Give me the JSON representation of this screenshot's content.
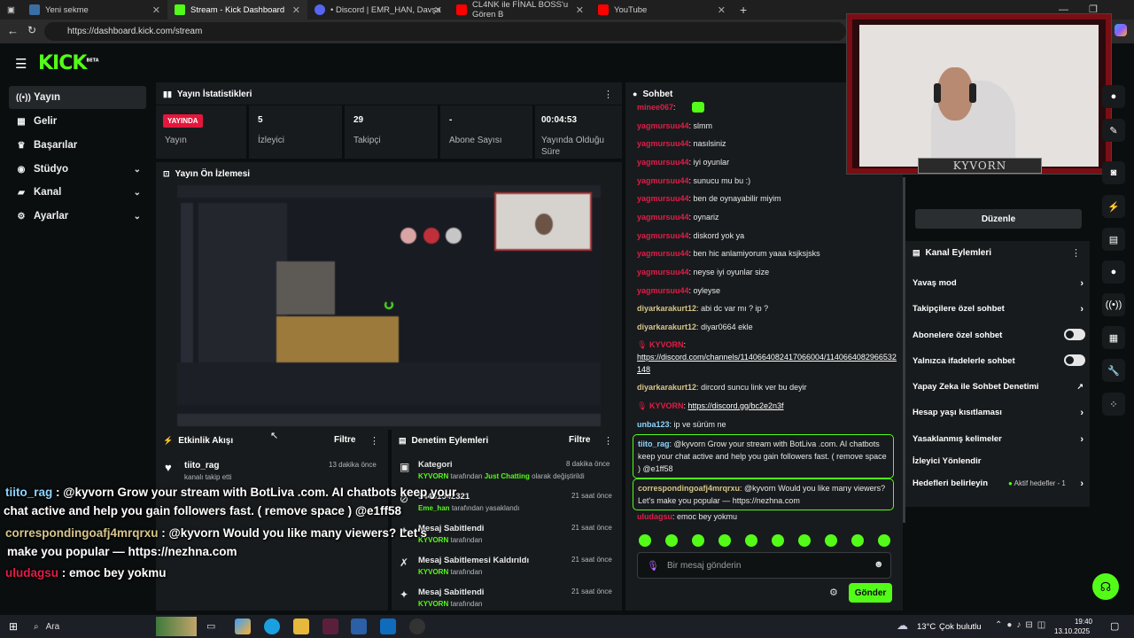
{
  "browser": {
    "tabs": [
      {
        "label": "Yeni sekme",
        "color": "#3a6ea5"
      },
      {
        "label": "Stream - Kick Dashboard",
        "color": "#53fc18"
      },
      {
        "label": "• Discord | EMR_HAN, Davşa",
        "color": "#5865f2"
      },
      {
        "label": "CL4NK ile FİNAL BOSS'u Gören B",
        "color": "#ff0000"
      },
      {
        "label": "YouTube",
        "color": "#ff0000"
      }
    ],
    "url": "https://dashboard.kick.com/stream"
  },
  "logo": {
    "text": "KICK",
    "sup": "BETA"
  },
  "sidebar": {
    "items": [
      {
        "label": "Yayın",
        "icon": "broadcast-icon"
      },
      {
        "label": "Gelir",
        "icon": "revenue-icon"
      },
      {
        "label": "Başarılar",
        "icon": "trophy-icon"
      },
      {
        "label": "Stüdyo",
        "icon": "studio-icon"
      },
      {
        "label": "Kanal",
        "icon": "channel-icon"
      },
      {
        "label": "Ayarlar",
        "icon": "gear-icon"
      }
    ]
  },
  "stats": {
    "title": "Yayın İstatistikleri",
    "live_badge": "YAYINDA",
    "items": [
      {
        "value": "",
        "label": "Yayın"
      },
      {
        "value": "5",
        "label": "İzleyici"
      },
      {
        "value": "29",
        "label": "Takipçi"
      },
      {
        "value": "-",
        "label": "Abone Sayısı"
      },
      {
        "value": "00:04:53",
        "label": "Yayında Olduğu Süre"
      }
    ]
  },
  "preview": {
    "title": "Yayın Ön İzlemesi"
  },
  "activity": {
    "title": "Etkinlik Akışı",
    "filter": "Filtre",
    "rows": [
      {
        "user": "tiito_rag",
        "desc": "kanalı takip etti",
        "time": "13 dakika önce"
      }
    ]
  },
  "moderation": {
    "title": "Denetim Eylemleri",
    "filter": "Filtre",
    "rows": [
      {
        "title": "Kategori",
        "actor": "KYVORN",
        "rest": "tarafından",
        "extra": "Just Chatting",
        "tail": "olarak değiştirildi",
        "time": "8 dakika önce"
      },
      {
        "title": "34461542321",
        "actor": "Eme_han",
        "rest": "tarafından yasaklandı",
        "extra": "",
        "tail": "",
        "time": "21 saat önce"
      },
      {
        "title": "Mesaj Sabitlendi",
        "actor": "KYVORN",
        "rest": "tarafından",
        "extra": "",
        "tail": "",
        "time": "21 saat önce"
      },
      {
        "title": "Mesaj Sabitlemesi Kaldırıldı",
        "actor": "KYVORN",
        "rest": "tarafından",
        "extra": "",
        "tail": "",
        "time": "21 saat önce"
      },
      {
        "title": "Mesaj Sabitlendi",
        "actor": "KYVORN",
        "rest": "tarafından",
        "extra": "",
        "tail": "",
        "time": "21 saat önce"
      }
    ]
  },
  "chat": {
    "title": "Sohbet",
    "messages": [
      {
        "user": "minee067",
        "text": "",
        "color": "#e11d48"
      },
      {
        "user": "yagmursuu44",
        "text": "slmm",
        "color": "#e11d48"
      },
      {
        "user": "yagmursuu44",
        "text": "nasılsiniz",
        "color": "#e11d48"
      },
      {
        "user": "yagmursuu44",
        "text": "iyi oyunlar",
        "color": "#e11d48"
      },
      {
        "user": "yagmursuu44",
        "text": "sunucu mu bu :)",
        "color": "#e11d48"
      },
      {
        "user": "yagmursuu44",
        "text": "ben de oynayabilir miyim",
        "color": "#e11d48"
      },
      {
        "user": "yagmursuu44",
        "text": "oynariz",
        "color": "#e11d48"
      },
      {
        "user": "yagmursuu44",
        "text": "diskord yok ya",
        "color": "#e11d48"
      },
      {
        "user": "yagmursuu44",
        "text": "ben hic anlamiyorum yaaa ksjksjsks",
        "color": "#e11d48"
      },
      {
        "user": "yagmursuu44",
        "text": "neyse iyi oyunlar size",
        "color": "#e11d48"
      },
      {
        "user": "yagmursuu44",
        "text": "oyleyse",
        "color": "#e11d48"
      },
      {
        "user": "diyarkarakurt12",
        "text": "abi dc var mı ? ip ?",
        "color": "#d7c58a"
      },
      {
        "user": "diyarkarakurt12",
        "text": "diyar0664 ekle",
        "color": "#d7c58a"
      }
    ],
    "kyvorn1_user": "KYVORN",
    "kyvorn1_link": "https://discord.com/channels/1140664082417066004/1140664082966532148",
    "diyar3_user": "diyarkarakurt12",
    "diyar3_text": "dircord suncu link ver bu deyir",
    "kyvorn2_user": "KYVORN",
    "kyvorn2_link": "https://discord.gg/bc2e2n3f",
    "unba_user": "unba123",
    "unba_text": "ip ve sürüm ne",
    "tiito_user": "tiito_rag",
    "tiito_text": "@kyvorn Grow your stream with BotLiva .com. AI chatbots keep your chat active and help you gain followers fast. ( remove space ) @e1ff58",
    "corr_user": "correspondingoafj4mrqrxu",
    "corr_text": "@kyvorn Would you like many viewers? Let's make you popular — https://nezhna.com",
    "ulu_user": "uludagsu",
    "ulu_text": "emoc bey yokmu",
    "input_placeholder": "Bir mesaj gönderin",
    "send": "Gönder"
  },
  "overlay": {
    "l1_user": "tiito_rag",
    "l1_text": ": @kyvorn Grow your stream with BotLiva .com. AI chatbots keep your",
    "l2_text": "chat active and help you gain followers fast. ( remove space ) @e1ff58",
    "l3_user": "correspondingoafj4mrqrxu",
    "l3_text": ": @kyvorn Would you like many viewers? Let's",
    "l4_text": "make you popular — https://nezhna.com",
    "l5_user": "uludagsu",
    "l5_text": ": emoc bey yokmu"
  },
  "webcam": {
    "name": "KYVORN"
  },
  "right": {
    "edit_button": "Düzenle",
    "actions_title": "Kanal Eylemleri",
    "actions": [
      {
        "label": "Yavaş mod",
        "kind": "arrow"
      },
      {
        "label": "Takipçilere özel sohbet",
        "kind": "arrow"
      },
      {
        "label": "Abonelere özel sohbet",
        "kind": "toggle"
      },
      {
        "label": "Yalnızca ifadelerle sohbet",
        "kind": "toggle"
      },
      {
        "label": "Yapay Zeka ile Sohbet Denetimi",
        "kind": "external"
      },
      {
        "label": "Hesap yaşı kısıtlaması",
        "kind": "arrow"
      },
      {
        "label": "Yasaklanmış kelimeler",
        "kind": "arrow"
      },
      {
        "label": "İzleyici Yönlendir",
        "kind": "none"
      },
      {
        "label": "Hedefleri belirleyin",
        "kind": "arrow"
      }
    ],
    "goals_status": "Aktif hedefler - 1"
  },
  "taskbar": {
    "search": "Ara",
    "weather_temp": "13°C",
    "weather_text": "Çok bulutlu",
    "time": "19:40",
    "date": "13.10.2025"
  },
  "colors": {
    "accent": "#53fc18",
    "live": "#e3173c",
    "panel": "#181b1d",
    "bg": "#0b0e0f"
  }
}
